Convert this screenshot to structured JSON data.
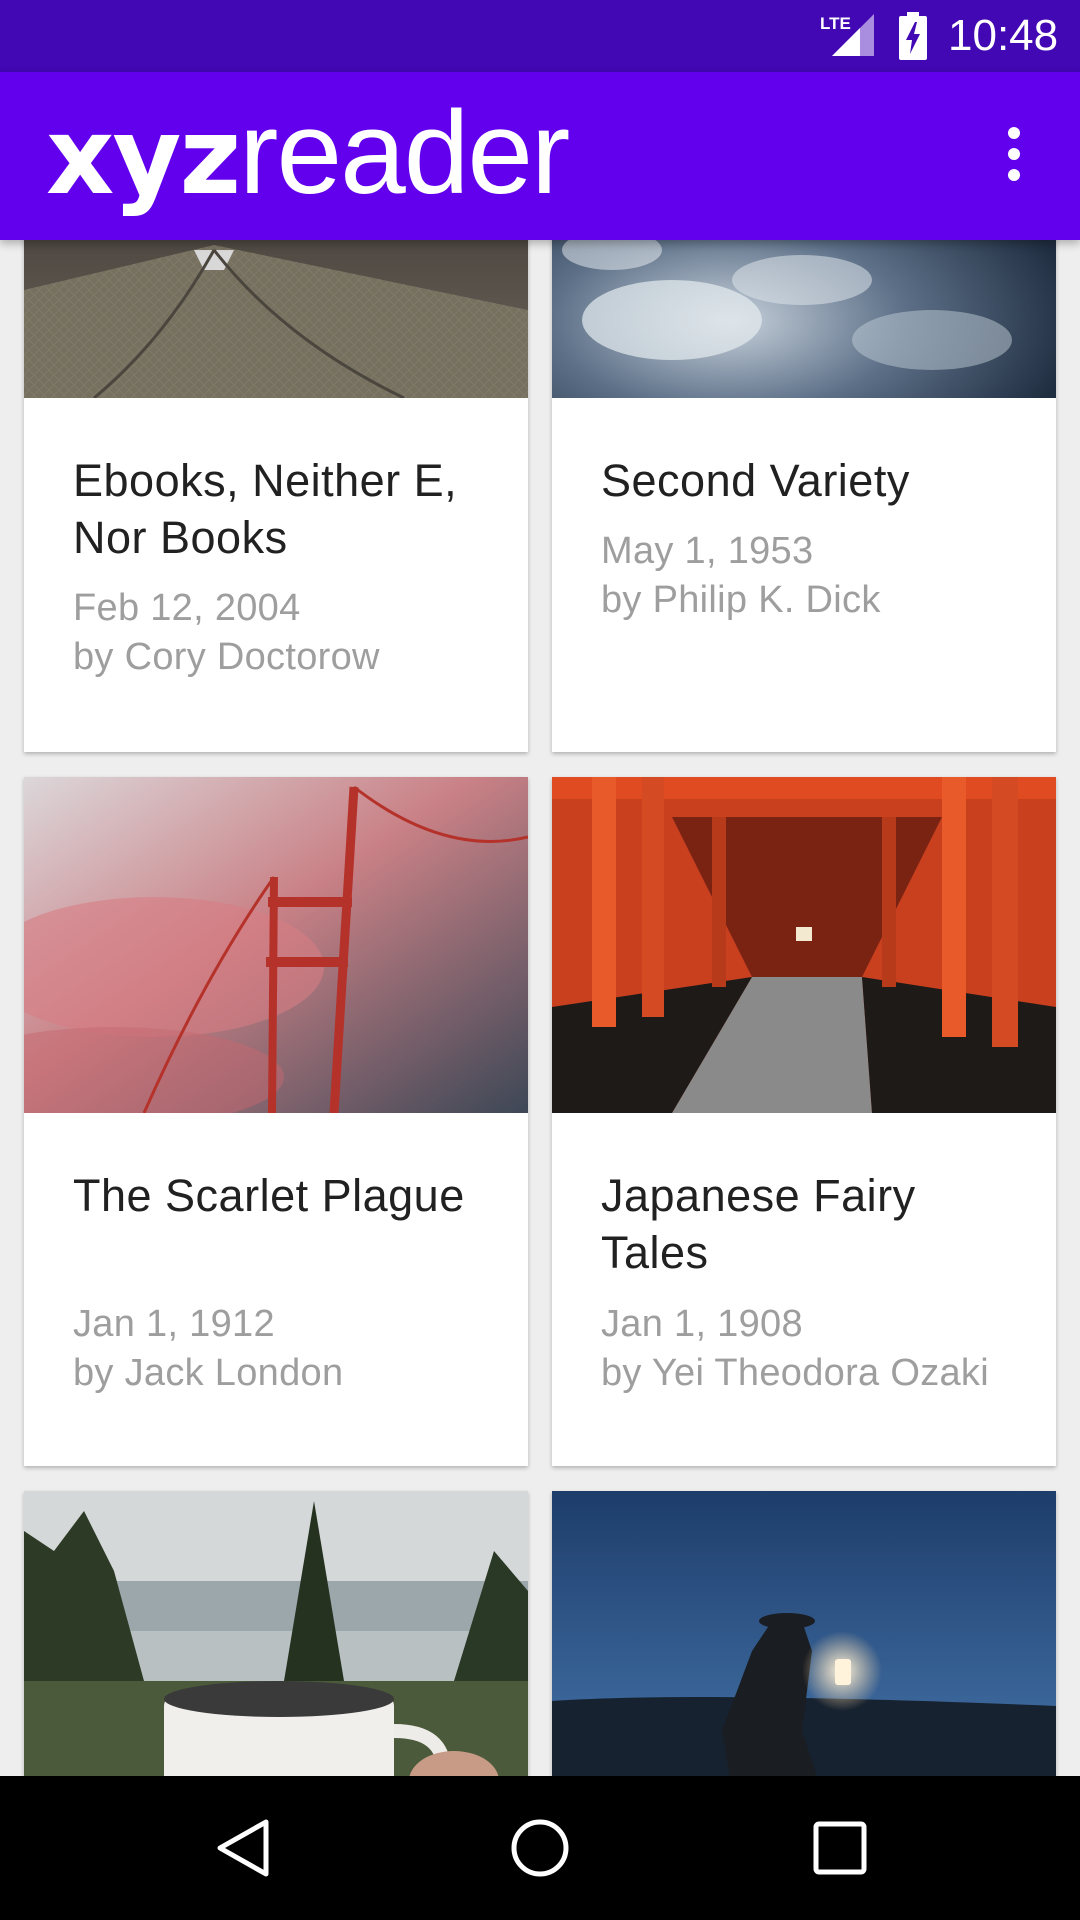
{
  "status_bar": {
    "network": "LTE",
    "time": "10:48"
  },
  "app_bar": {
    "logo_bold": "xyz",
    "logo_light": "reader",
    "menu_icon": "overflow-menu-icon"
  },
  "articles": [
    {
      "title": "Ebooks, Neither E, Nor Books",
      "date": "Feb 12, 2004",
      "author": "by Cory Doctorow",
      "image": "building-interior-photo"
    },
    {
      "title": "Second Variety",
      "date": "May 1, 1953",
      "author": "by Philip K. Dick",
      "image": "earth-clouds-photo"
    },
    {
      "title": "The Scarlet Plague",
      "date": "Jan 1, 1912",
      "author": "by Jack London",
      "image": "golden-gate-fog-photo"
    },
    {
      "title": "Japanese Fairy Tales",
      "date": "Jan 1, 1908",
      "author": "by Yei Theodora Ozaki",
      "image": "torii-gates-photo"
    },
    {
      "title": "",
      "date": "",
      "author": "",
      "image": "lake-mug-photo"
    },
    {
      "title": "",
      "date": "",
      "author": "",
      "image": "lantern-night-photo"
    }
  ],
  "nav_bar": {
    "back": "back-icon",
    "home": "home-icon",
    "recents": "recents-icon"
  },
  "colors": {
    "status_bar": "#4108b3",
    "app_bar": "#6200ee",
    "background": "#eeeeee",
    "title_text": "#212121",
    "meta_text": "#9e9e9e"
  }
}
